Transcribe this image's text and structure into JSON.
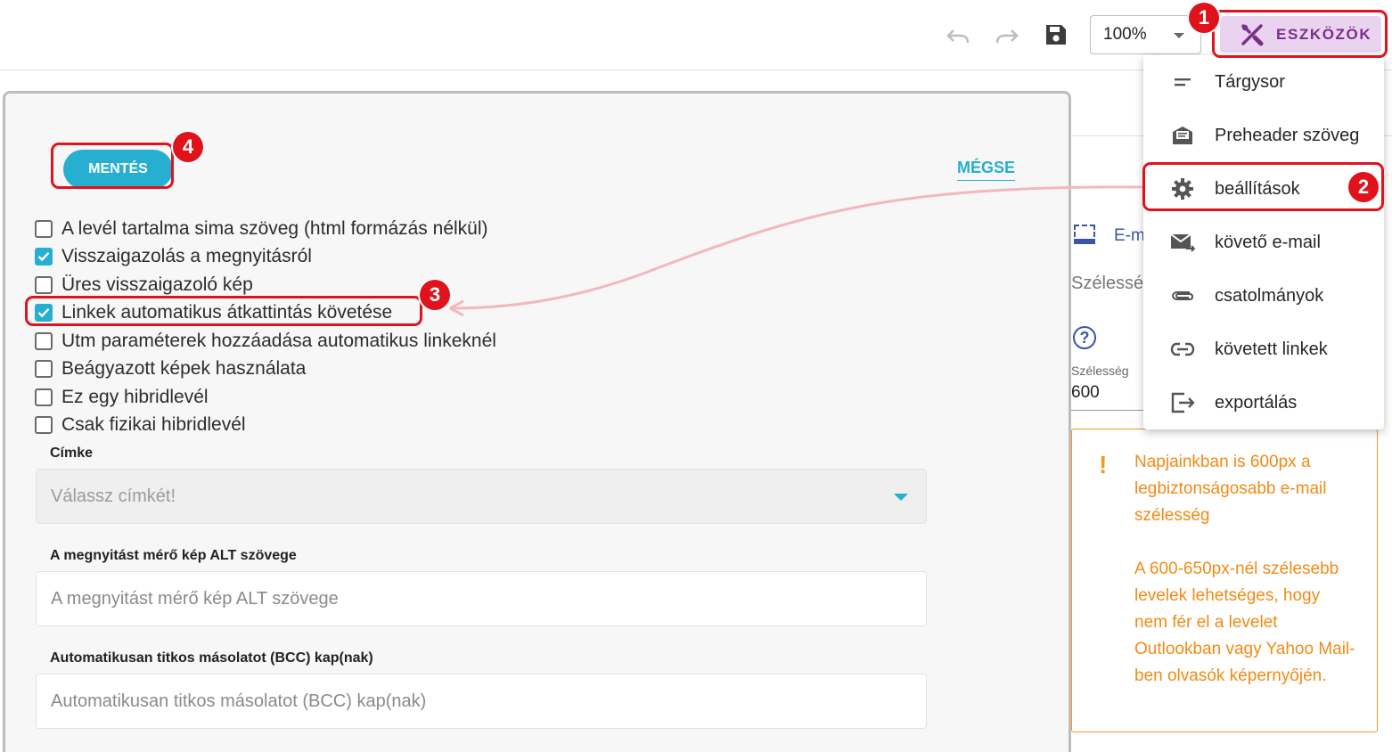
{
  "toolbar": {
    "undo_icon": "undo-icon",
    "redo_icon": "redo-icon",
    "save_icon": "floppy-disk-icon",
    "zoom_value": "100%",
    "tools_label": "ESZKÖZÖK",
    "tools_icon": "tools-icon"
  },
  "menu": {
    "items": [
      {
        "label": "Tárgysor",
        "icon": "subject-line-icon"
      },
      {
        "label": "Preheader szöveg",
        "icon": "preheader-icon"
      },
      {
        "label": "beállítások",
        "icon": "gear-icon"
      },
      {
        "label": "követő e-mail",
        "icon": "follow-up-mail-icon"
      },
      {
        "label": "csatolmányok",
        "icon": "paperclip-icon"
      },
      {
        "label": "követett linkek",
        "icon": "link-icon"
      },
      {
        "label": "exportálás",
        "icon": "export-icon"
      }
    ]
  },
  "annotations": [
    "1",
    "2",
    "3",
    "4"
  ],
  "modal": {
    "save_label": "MENTÉS",
    "cancel_label": "MÉGSE",
    "checkboxes": [
      {
        "label": "A levél tartalma sima szöveg (html formázás nélkül)",
        "checked": false
      },
      {
        "label": "Visszaigazolás a megnyitásról",
        "checked": true
      },
      {
        "label": "Üres visszaigazoló kép",
        "checked": false
      },
      {
        "label": "Linkek automatikus átkattintás követése",
        "checked": true
      },
      {
        "label": "Utm paraméterek hozzáadása automatikus linkeknél",
        "checked": false
      },
      {
        "label": "Beágyazott képek használata",
        "checked": false
      },
      {
        "label": "Ez egy hibridlevél",
        "checked": false
      },
      {
        "label": "Csak fizikai hibridlevél",
        "checked": false
      }
    ],
    "tag_label": "Címke",
    "tag_placeholder": "Válassz címkét!",
    "alt_label": "A megnyitást mérő kép ALT szövege",
    "alt_placeholder": "A megnyitást mérő kép ALT szövege",
    "bcc_label": "Automatikusan titkos másolatot (BCC) kap(nak)",
    "bcc_placeholder": "Automatikusan titkos másolatot (BCC) kap(nak)"
  },
  "background": {
    "email_tab_label": "E-m",
    "width_heading": "Szélessé",
    "help_icon": "help-circle-icon",
    "width_small_label": "Szélesség",
    "width_value": "600",
    "warning_icon": "exclamation-icon",
    "warning_text_1": "Napjainkban is 600px a legbiztonságosabb e-mail szélesség",
    "warning_text_2": "A 600-650px-nél szélesebb levelek lehetséges, hogy nem fér el a levelet Outlookban vagy Yahoo Mail-ben olvasók képernyőjén."
  },
  "colors": {
    "accent": "#26afd0",
    "tools_bg": "#ead3ef",
    "tools_fg": "#7a2f8a",
    "annotation_red": "#e0121b",
    "warning_orange": "#f28a13"
  }
}
